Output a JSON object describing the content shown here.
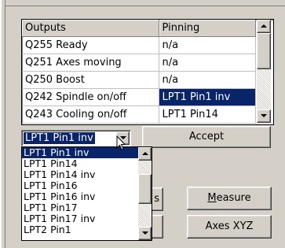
{
  "table": {
    "headers": [
      "Outputs",
      "Pinning"
    ],
    "rows": [
      {
        "output": "Q255 Ready",
        "pinning": "n/a"
      },
      {
        "output": "Q251 Axes moving",
        "pinning": "n/a"
      },
      {
        "output": "Q250 Boost",
        "pinning": "n/a"
      },
      {
        "output": "Q242 Spindle on/off",
        "pinning": "LPT1 Pin1 inv"
      },
      {
        "output": "Q243 Cooling on/off",
        "pinning": "LPT1 Pin14"
      }
    ]
  },
  "combo": {
    "value": "LPT1 Pin1 inv",
    "options": [
      "LPT1 Pin1 inv",
      "LPT1 Pin14",
      "LPT1 Pin14 inv",
      "LPT1 Pin16",
      "LPT1 Pin16 inv",
      "LPT1 Pin17",
      "LPT1 Pin17 inv",
      "LPT2 Pin1"
    ]
  },
  "buttons": {
    "accept": "Accept",
    "measure_first": "M",
    "measure_rest": "easure",
    "axes_xyz": "Axes XYZ",
    "partial_s": "s"
  },
  "icons": {
    "scroll_up": "arrow-up-icon",
    "scroll_down": "arrow-down-icon",
    "combo_open": "chevron-down-icon",
    "cursor": "mouse-pointer-icon"
  },
  "colors": {
    "selection": "#0a246a",
    "face": "#d4d0c8"
  }
}
